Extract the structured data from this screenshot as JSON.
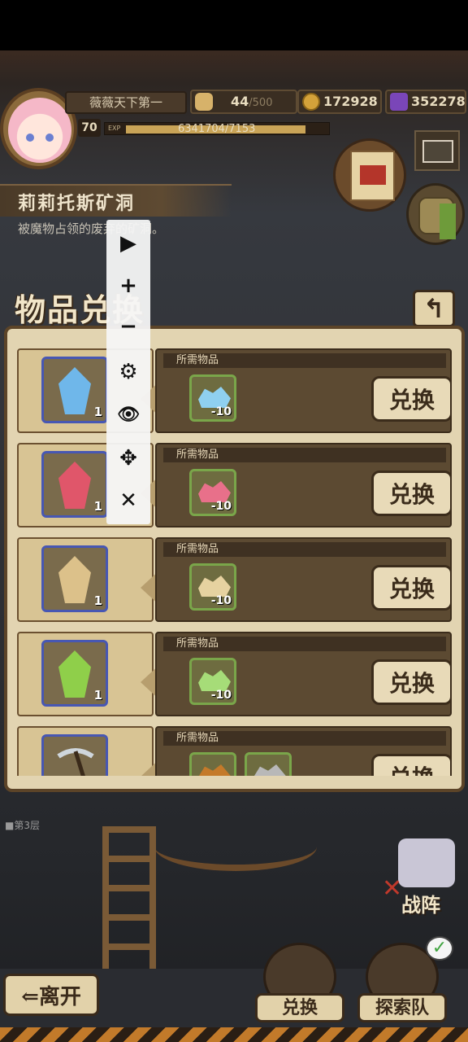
{
  "player": {
    "name": "薇薇天下第一",
    "level": "70",
    "exp_label": "EXP",
    "exp_text": "6341704/7153",
    "exp_fraction": 0.89
  },
  "resources": {
    "stamina": "44",
    "stamina_max": "/500",
    "gold": "172928",
    "gems": "352278"
  },
  "location": {
    "title": "莉莉托斯矿洞",
    "description": "被魔物占领的废弃的矿洞。"
  },
  "toolbar": {
    "play": "▶",
    "zoom_in": "+",
    "zoom_out": "−",
    "settings": "⚙",
    "view": "👁",
    "move": "✥",
    "close": "✕"
  },
  "exchange_panel": {
    "title": "物品兑换",
    "back": "↰",
    "rows": [
      {
        "required_label": "所需物品",
        "reward_count": "1",
        "cost_count": "10",
        "button": "兑换",
        "color": "#6fb7ea"
      },
      {
        "required_label": "所需物品",
        "reward_count": "1",
        "cost_count": "10",
        "button": "兑换",
        "color": "#e0566a"
      },
      {
        "required_label": "所需物品",
        "reward_count": "1",
        "cost_count": "10",
        "button": "兑换",
        "color": "#dcc18a"
      },
      {
        "required_label": "所需物品",
        "reward_count": "1",
        "cost_count": "10",
        "button": "兑换",
        "color": "#8fcf4a"
      },
      {
        "required_label": "所需物品",
        "button": "兑换"
      }
    ]
  },
  "scene": {
    "floor": "■第3层"
  },
  "bottom": {
    "leave": "⇐离开",
    "exchange": "兑换",
    "explore_team": "探索队",
    "formation": "战阵",
    "check": "✓"
  }
}
